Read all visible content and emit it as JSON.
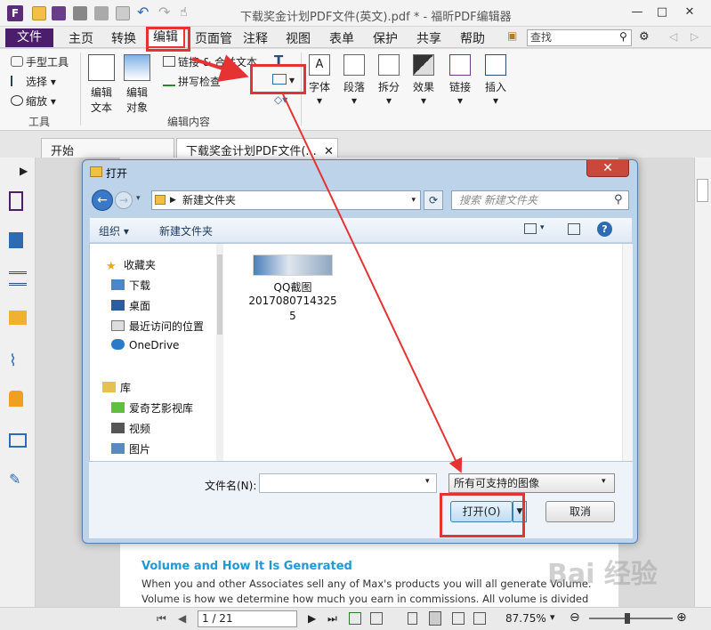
{
  "titlebar": {
    "doc_title": "下载奖金计划PDF文件(英文).pdf * - 福昕PDF编辑器",
    "minimize": "—",
    "maximize": "□",
    "close": "✕"
  },
  "menubar": {
    "file": "文件",
    "items": [
      "主页",
      "转换",
      "编辑",
      "页面管",
      "注释",
      "视图",
      "表单",
      "保护",
      "共享",
      "帮助"
    ],
    "search_placeholder": "查找"
  },
  "ribbon": {
    "tools_group": {
      "hand": "手型工具",
      "select": "选择",
      "zoom": "缩放",
      "label": "工具"
    },
    "edit_group": {
      "edit_text_1": "编辑",
      "edit_text_2": "文本",
      "edit_object_1": "编辑",
      "edit_object_2": "对象",
      "link_merge": "链接 & 合并文本",
      "spellcheck": "拼写检查",
      "label": "编辑内容"
    },
    "font": "字体",
    "paragraph": "段落",
    "split": "拆分",
    "effect": "效果",
    "link": "链接",
    "insert": "插入"
  },
  "tabs": {
    "start": "开始",
    "document": "下载奖金计划PDF文件(..."
  },
  "dialog": {
    "title": "打开",
    "breadcrumb": "新建文件夹",
    "search_placeholder": "搜索 新建文件夹",
    "organize": "组织",
    "new_folder": "新建文件夹",
    "nav": {
      "favorites": "收藏夹",
      "downloads": "下载",
      "desktop": "桌面",
      "recent": "最近访问的位置",
      "onedrive": "OneDrive",
      "library": "库",
      "iqiyi": "爱奇艺影视库",
      "video": "视频",
      "pictures": "图片"
    },
    "file": {
      "name_line1": "QQ截图",
      "name_line2": "2017080714325",
      "name_line3": "5"
    },
    "filename_label": "文件名(N):",
    "filename_value": "",
    "filetype": "所有可支持的图像",
    "open": "打开(O)",
    "cancel": "取消"
  },
  "document": {
    "heading": "Volume and How It Is Generated",
    "line1": "When you and other Associates sell any of Max's products you will all generate Volume.",
    "line2": "Volume is how we determine how much you earn in commissions. All volume is divided"
  },
  "statusbar": {
    "page": "1 / 21",
    "zoom": "87.75%"
  },
  "watermark": "Bai 经验",
  "colors": {
    "accent_purple": "#4b1d6b",
    "annotation_red": "#e53333",
    "heading_blue": "#1e9ad6"
  }
}
